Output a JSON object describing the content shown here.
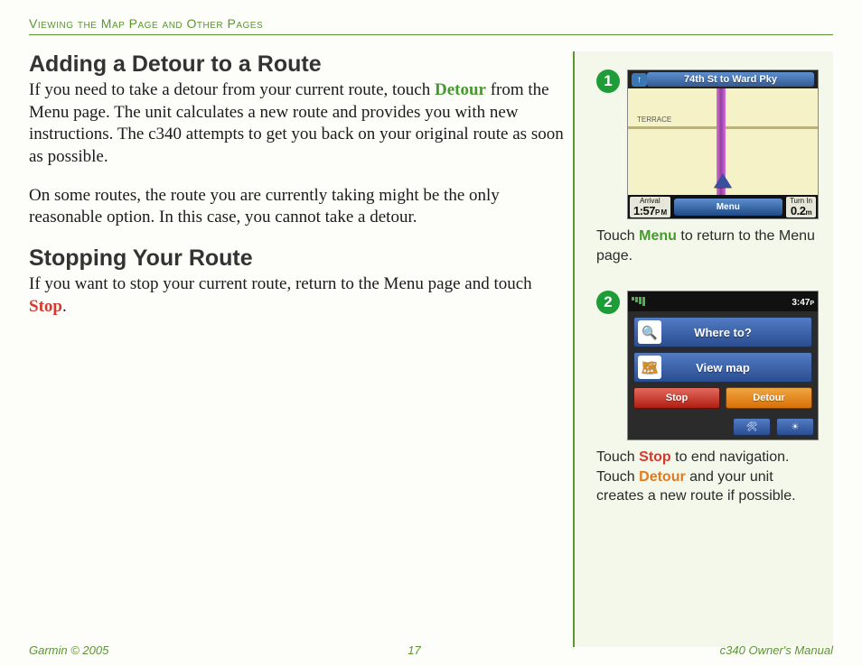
{
  "header": {
    "breadcrumb": "Viewing the Map Page and Other Pages"
  },
  "left": {
    "h1": "Adding a Detour to a Route",
    "p1a": "If you need to take a detour from your current route, touch ",
    "p1_kw": "Detour",
    "p1b": " from the Menu page. The unit calculates a new route and provides you with new instructions. The c340 attempts to get you back on your original route as soon as possible.",
    "p2": "On some routes, the route you are currently taking might be the only reasonable option. In this case, you cannot take a detour.",
    "h2": "Stopping Your Route",
    "p3a": "If you want to stop your current route, return to the Menu page and touch ",
    "p3_kw": "Stop",
    "p3b": "."
  },
  "right": {
    "step1": {
      "num": "1",
      "dest": "74th St to Ward Pky",
      "dest_arrow": "↑",
      "map_label": "TERRACE",
      "arrival_label": "Arrival",
      "arrival_time": "1:57",
      "arrival_ampm": "P M",
      "menu_btn": "Menu",
      "turn_label": "Turn In",
      "turn_dist": "0.2",
      "turn_unit": "m",
      "caption_a": "Touch ",
      "caption_kw": "Menu",
      "caption_b": " to return to the Menu page."
    },
    "step2": {
      "num": "2",
      "time": "3:47",
      "time_ampm": "P",
      "where_to": "Where to?",
      "view_map": "View map",
      "stop_btn": "Stop",
      "detour_btn": "Detour",
      "caption_a": "Touch ",
      "caption_kw1": "Stop",
      "caption_b": " to end navigation. Touch ",
      "caption_kw2": "Detour",
      "caption_c": " and your unit creates a new route if possible."
    }
  },
  "footer": {
    "left": "Garmin © 2005",
    "center": "17",
    "right": "c340 Owner's Manual"
  }
}
